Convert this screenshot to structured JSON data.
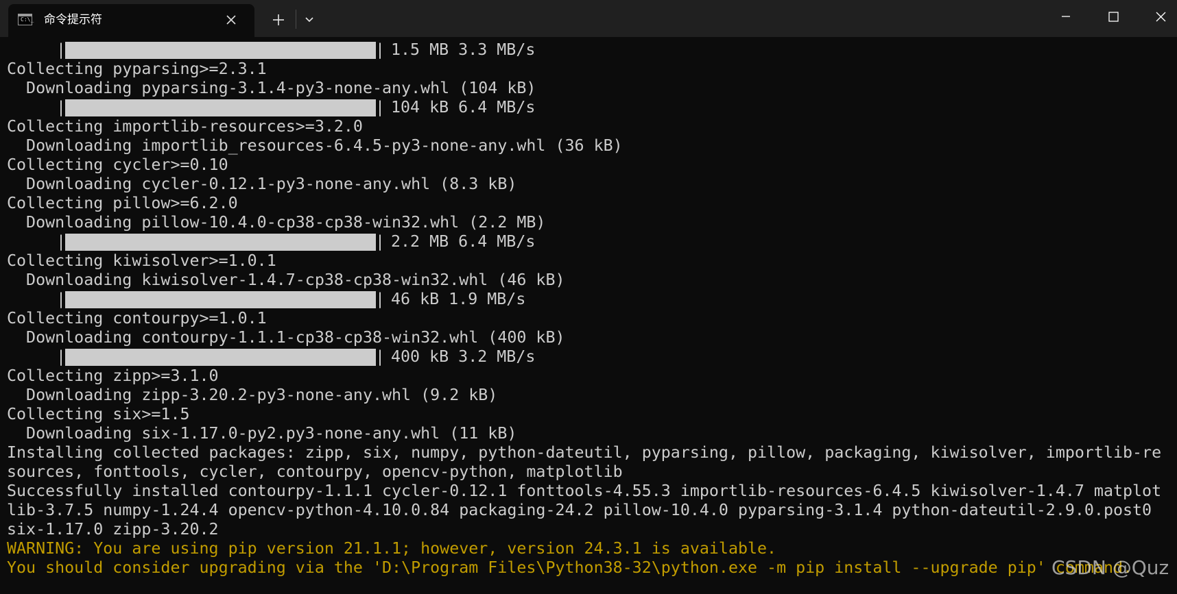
{
  "window": {
    "tab_title": "命令提示符",
    "tab_icon_text": "C:\\_",
    "new_tab_label": "+",
    "colors": {
      "background": "#0c0c0c",
      "titlebar": "#202020",
      "text": "#cccccc",
      "warning": "#c19c00"
    }
  },
  "terminal": {
    "lines": [
      {
        "kind": "progress",
        "fraction": 1.0,
        "text": "1.5 MB 3.3 MB/s"
      },
      {
        "kind": "text",
        "text": "Collecting pyparsing>=2.3.1"
      },
      {
        "kind": "text",
        "text": "  Downloading pyparsing-3.1.4-py3-none-any.whl (104 kB)"
      },
      {
        "kind": "progress",
        "fraction": 1.0,
        "text": "104 kB 6.4 MB/s"
      },
      {
        "kind": "text",
        "text": "Collecting importlib-resources>=3.2.0"
      },
      {
        "kind": "text",
        "text": "  Downloading importlib_resources-6.4.5-py3-none-any.whl (36 kB)"
      },
      {
        "kind": "text",
        "text": "Collecting cycler>=0.10"
      },
      {
        "kind": "text",
        "text": "  Downloading cycler-0.12.1-py3-none-any.whl (8.3 kB)"
      },
      {
        "kind": "text",
        "text": "Collecting pillow>=6.2.0"
      },
      {
        "kind": "text",
        "text": "  Downloading pillow-10.4.0-cp38-cp38-win32.whl (2.2 MB)"
      },
      {
        "kind": "progress",
        "fraction": 1.0,
        "text": "2.2 MB 6.4 MB/s"
      },
      {
        "kind": "text",
        "text": "Collecting kiwisolver>=1.0.1"
      },
      {
        "kind": "text",
        "text": "  Downloading kiwisolver-1.4.7-cp38-cp38-win32.whl (46 kB)"
      },
      {
        "kind": "progress",
        "fraction": 1.0,
        "text": "46 kB 1.9 MB/s"
      },
      {
        "kind": "text",
        "text": "Collecting contourpy>=1.0.1"
      },
      {
        "kind": "text",
        "text": "  Downloading contourpy-1.1.1-cp38-cp38-win32.whl (400 kB)"
      },
      {
        "kind": "progress",
        "fraction": 1.0,
        "text": "400 kB 3.2 MB/s"
      },
      {
        "kind": "text",
        "text": "Collecting zipp>=3.1.0"
      },
      {
        "kind": "text",
        "text": "  Downloading zipp-3.20.2-py3-none-any.whl (9.2 kB)"
      },
      {
        "kind": "text",
        "text": "Collecting six>=1.5"
      },
      {
        "kind": "text",
        "text": "  Downloading six-1.17.0-py2.py3-none-any.whl (11 kB)"
      },
      {
        "kind": "text",
        "text": "Installing collected packages: zipp, six, numpy, python-dateutil, pyparsing, pillow, packaging, kiwisolver, importlib-re"
      },
      {
        "kind": "text",
        "text": "sources, fonttools, cycler, contourpy, opencv-python, matplotlib"
      },
      {
        "kind": "text",
        "text": "Successfully installed contourpy-1.1.1 cycler-0.12.1 fonttools-4.55.3 importlib-resources-6.4.5 kiwisolver-1.4.7 matplot"
      },
      {
        "kind": "text",
        "text": "lib-3.7.5 numpy-1.24.4 opencv-python-4.10.0.84 packaging-24.2 pillow-10.4.0 pyparsing-3.1.4 python-dateutil-2.9.0.post0"
      },
      {
        "kind": "text",
        "text": "six-1.17.0 zipp-3.20.2"
      },
      {
        "kind": "warn",
        "text": "WARNING: You are using pip version 21.1.1; however, version 24.3.1 is available."
      },
      {
        "kind": "warn",
        "text": "You should consider upgrading via the 'D:\\Program Files\\Python38-32\\python.exe -m pip install --upgrade pip' command."
      }
    ]
  },
  "watermark": "CSDN @Quz"
}
